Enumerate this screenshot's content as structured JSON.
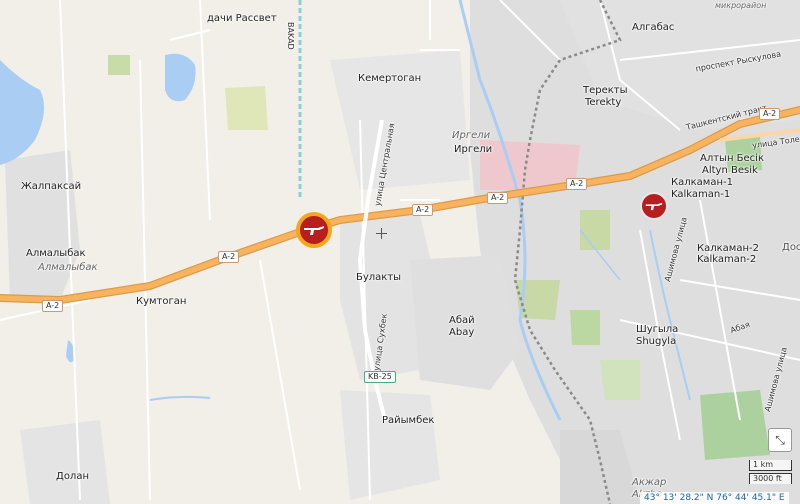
{
  "places": {
    "dachi_rassvet": "дачи Рассвет",
    "bakad": "BAKAD",
    "kemertogan": "Кемертоган",
    "algabas": "Алгабас",
    "prospekt_ryskulova": "проспект Рыскулова",
    "mikrorayon": "микрорайон",
    "terekty_ru": "Теректы",
    "terekty_latin": "Terekty",
    "tashkentsky_trakt": "Ташкентский тракт",
    "ulitsa_tole_bi": "улица Толе Би",
    "irgeli_ital": "Иргели",
    "irgeli": "Иргели",
    "altyn_besik_ru": "Алтын Бесік",
    "altyn_besik_latin": "Altyn Besik",
    "kalkaman1_ru": "Калкаман-1",
    "kalkaman1_latin": "Kalkaman-1",
    "zhalpaksai": "Жалпаксай",
    "ulitsa_tsentralnaya": "улица Центральная",
    "almalybak": "Алмалыбак",
    "almalybak_ital": "Алмалыбак",
    "kumtogan": "Кумтоган",
    "bulakty": "Булакты",
    "kalkaman2_ru": "Калкаман-2",
    "kalkaman2_latin": "Kalkaman-2",
    "ashimova_ulitsa": "Ашимова улица",
    "abai_ru": "Абай",
    "abai_latin": "Abay",
    "abaya": "Абая",
    "ulitsa_sukhbek": "улица Сухбек",
    "shugyla_ru": "Шугыла",
    "shugyla_latin": "Shugyla",
    "ashimova_ulitsa_2": "Ашимова улица",
    "raiymbek": "Райымбек",
    "dolan": "Долан",
    "akzhar_ru": "Акжар",
    "akzhar_latin": "Akzha",
    "dos": "Дос"
  },
  "roads": {
    "a2_1": "A-2",
    "a2_2": "A-2",
    "a2_3": "A-2",
    "a2_4": "A-2",
    "a2_5": "A-2",
    "a2_6": "A-2",
    "kv25": "KB-25"
  },
  "markers": [
    {
      "name": "rifle-icon",
      "style": "highlighted"
    },
    {
      "name": "rifle-icon",
      "style": "normal"
    }
  ],
  "scale": {
    "km": "1 km",
    "ft": "3000 ft"
  },
  "coords": "43° 13' 28.2\" N 76° 44' 45.1\" E",
  "colors": {
    "road_major": "#f9b25d",
    "water": "#a9cdf3",
    "residential": "#dcdcdc",
    "park": "#add19e",
    "marker": "#b71e1e",
    "marker_ring": "#f4a71d"
  }
}
